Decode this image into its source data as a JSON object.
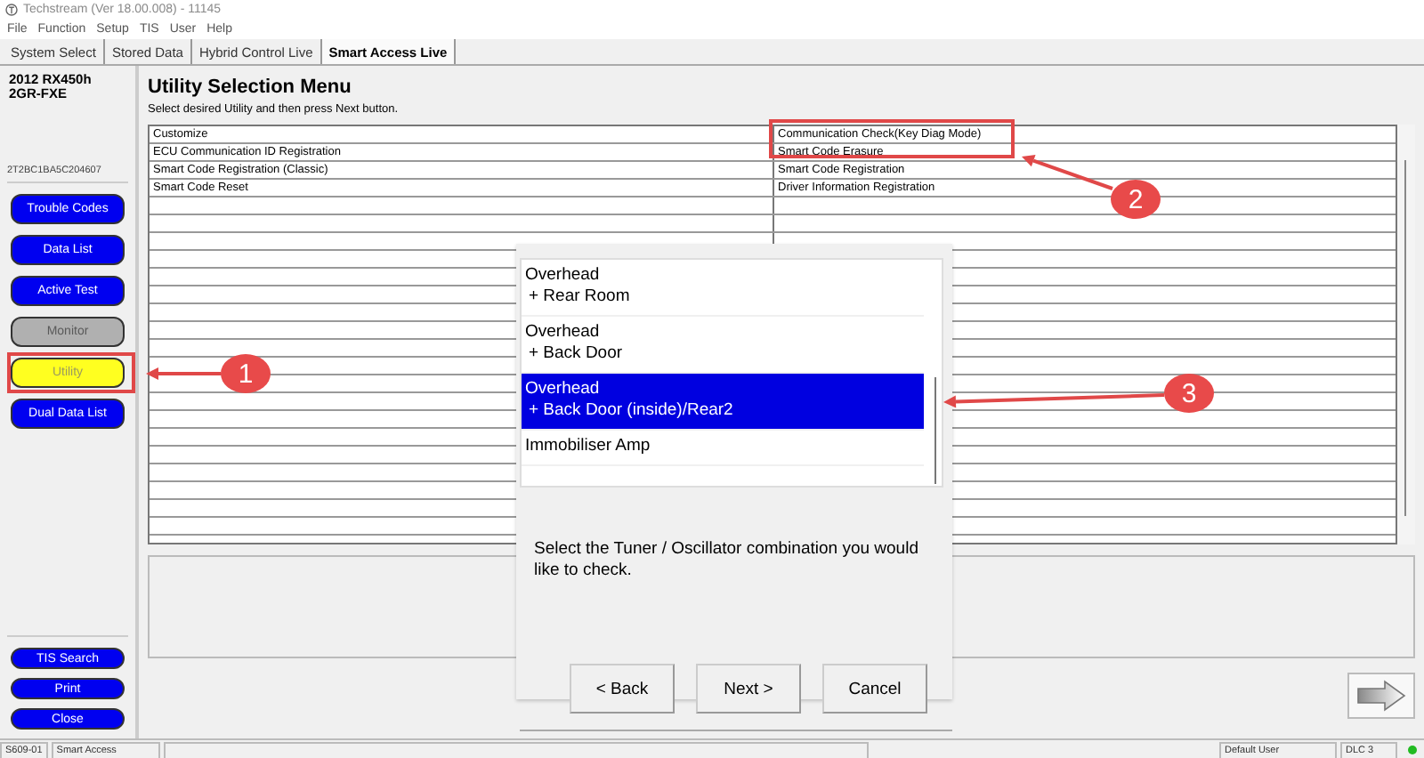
{
  "window": {
    "title": "Techstream (Ver 18.00.008) - 11145"
  },
  "menu": [
    "File",
    "Function",
    "Setup",
    "TIS",
    "User",
    "Help"
  ],
  "tabs": [
    {
      "label": "System Select",
      "selected": false
    },
    {
      "label": "Stored Data",
      "selected": false
    },
    {
      "label": "Hybrid Control Live",
      "selected": false
    },
    {
      "label": "Smart Access Live",
      "selected": true
    }
  ],
  "vehicle": {
    "model": "2012 RX450h",
    "engine": "2GR-FXE",
    "vin": "2T2BC1BA5C204607"
  },
  "sidebar": {
    "buttons": [
      {
        "label": "Trouble Codes",
        "disabled": false,
        "selected": false
      },
      {
        "label": "Data List",
        "disabled": false,
        "selected": false
      },
      {
        "label": "Active Test",
        "disabled": false,
        "selected": false
      },
      {
        "label": "Monitor",
        "disabled": true,
        "selected": false
      },
      {
        "label": "Utility",
        "disabled": false,
        "selected": true
      },
      {
        "label": "Dual Data List",
        "disabled": false,
        "selected": false
      }
    ],
    "bottom_buttons": [
      "TIS Search",
      "Print",
      "Close"
    ]
  },
  "heading": "Utility Selection Menu",
  "instruction": "Select desired Utility and then press Next button.",
  "table": {
    "rows": [
      [
        "Customize",
        "Communication Check(Key Diag Mode)"
      ],
      [
        "ECU Communication ID Registration",
        "Smart Code Erasure"
      ],
      [
        "Smart Code Registration (Classic)",
        "Smart Code Registration"
      ],
      [
        "Smart Code Reset",
        "Driver Information Registration"
      ]
    ]
  },
  "dialog": {
    "items": [
      {
        "lines": [
          "Overhead",
          "+ Rear Room"
        ],
        "selected": false
      },
      {
        "lines": [
          "Overhead",
          "+ Back Door"
        ],
        "selected": false
      },
      {
        "lines": [
          "Overhead",
          "+ Back Door (inside)/Rear2"
        ],
        "selected": true
      },
      {
        "lines": [
          "Immobiliser Amp"
        ],
        "selected": false
      }
    ],
    "description": "Select the Tuner / Oscillator combination you would like to check.",
    "buttons": [
      "< Back",
      "Next >",
      "Cancel"
    ]
  },
  "status_bar": {
    "code": "S609-01",
    "system": "Smart Access",
    "user": "Default User",
    "connection": "DLC 3"
  },
  "annotations": [
    {
      "number": "1"
    },
    {
      "number": "2"
    },
    {
      "number": "3"
    }
  ]
}
